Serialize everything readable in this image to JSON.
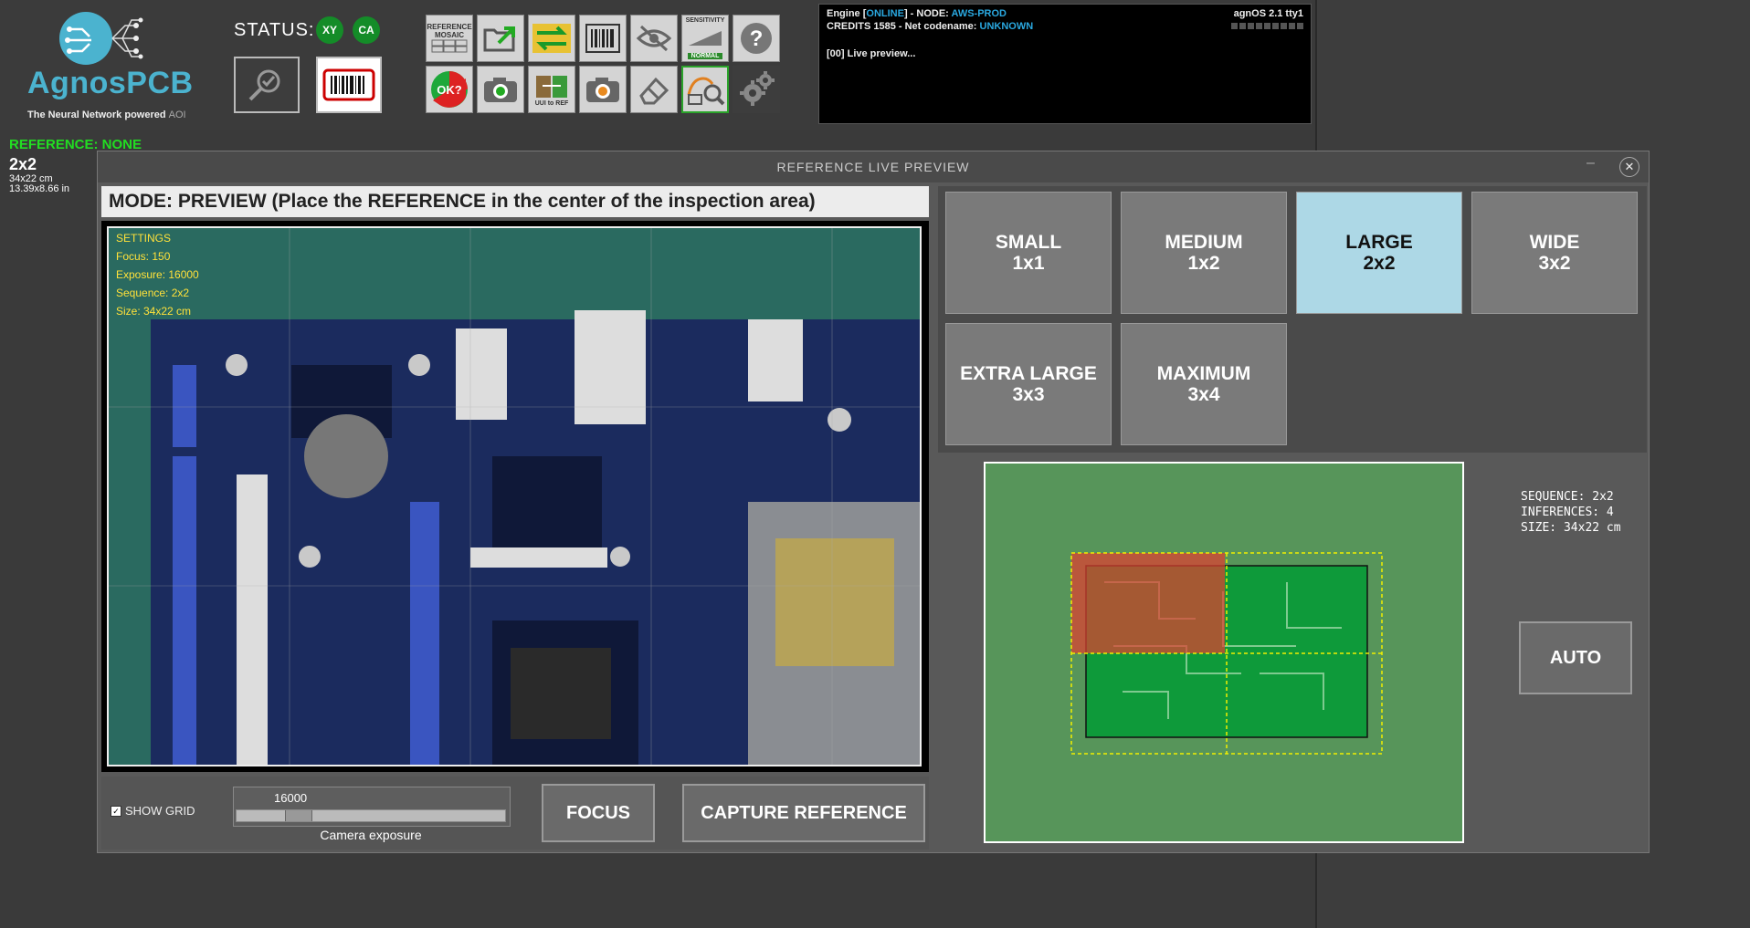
{
  "logo": {
    "brand": "AgnosPCB",
    "tagline": "The Neural Network powered",
    "tagline_suffix": "AOI"
  },
  "status": {
    "label": "STATUS:",
    "badges": [
      "XY",
      "CA"
    ]
  },
  "toolbar": {
    "top": [
      {
        "name": "reference-mosaic",
        "label": "REFERENCE MOSAIC"
      },
      {
        "name": "open-folder",
        "label": ""
      },
      {
        "name": "swap-arrows",
        "label": ""
      },
      {
        "name": "barcode",
        "label": ""
      },
      {
        "name": "hide-eye",
        "label": ""
      },
      {
        "name": "sensitivity",
        "label": "SENSITIVITY",
        "sub": "NORMAL"
      },
      {
        "name": "help",
        "label": ""
      }
    ],
    "bottom": [
      {
        "name": "ok-check",
        "label": "OK?"
      },
      {
        "name": "camera",
        "label": ""
      },
      {
        "name": "uui-to-ref",
        "label": "UUI to REF"
      },
      {
        "name": "camera-orange",
        "label": ""
      },
      {
        "name": "eraser",
        "label": ""
      },
      {
        "name": "inspect-zoom",
        "label": ""
      },
      {
        "name": "settings",
        "label": ""
      }
    ]
  },
  "console": {
    "engine_prefix": "Engine [",
    "engine_status": "ONLINE",
    "engine_mid": "] - NODE: ",
    "node": "AWS-PROD",
    "credits_line": "CREDITS 1585 - Net codename: ",
    "codename": "UNKNOWN",
    "log": "[00] Live preview...",
    "os": "agnOS 2.1 tty1"
  },
  "reference": {
    "label": "REFERENCE: NONE",
    "size": "2x2",
    "size_cm": "34x22 cm",
    "size_in": "13.39x8.66 in"
  },
  "dialog": {
    "title": "REFERENCE LIVE PREVIEW",
    "mode": "MODE: PREVIEW (Place the REFERENCE in the center of the inspection area)",
    "settings": {
      "title": "SETTINGS",
      "focus": "Focus: 150",
      "exposure": "Exposure: 16000",
      "sequence": "Sequence: 2x2",
      "size": "Size: 34x22 cm"
    },
    "show_grid_label": "SHOW GRID",
    "show_grid_checked": true,
    "exposure_value": "16000",
    "exposure_fraction": 0.2,
    "exposure_label": "Camera exposure",
    "focus_button": "FOCUS",
    "capture_button": "CAPTURE REFERENCE",
    "sizes": [
      {
        "name": "SMALL",
        "grid": "1x1",
        "active": false
      },
      {
        "name": "MEDIUM",
        "grid": "1x2",
        "active": false
      },
      {
        "name": "LARGE",
        "grid": "2x2",
        "active": true
      },
      {
        "name": "WIDE",
        "grid": "3x2",
        "active": false
      },
      {
        "name": "EXTRA LARGE",
        "grid": "3x3",
        "active": false
      },
      {
        "name": "MAXIMUM",
        "grid": "3x4",
        "active": false
      }
    ],
    "info": {
      "sequence": "SEQUENCE: 2x2",
      "inferences": "INFERENCES: 4",
      "size": "SIZE: 34x22 cm"
    },
    "auto_button": "AUTO"
  }
}
